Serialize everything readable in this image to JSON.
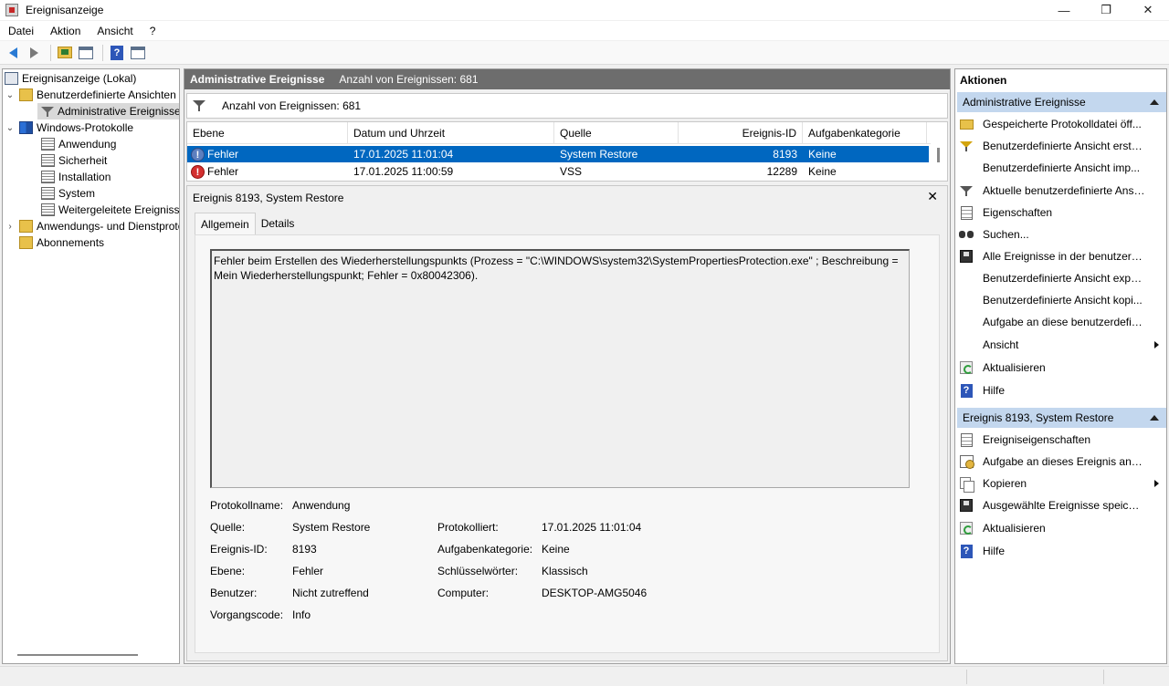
{
  "window": {
    "title": "Ereignisanzeige",
    "controls": {
      "minimize": "—",
      "maximize": "❐",
      "close": "✕"
    }
  },
  "menu": [
    "Datei",
    "Aktion",
    "Ansicht",
    "?"
  ],
  "toolbar": {
    "icons": [
      "back-arrow",
      "forward-arrow",
      "up-folder",
      "show-hide-console-tree",
      "help",
      "show-hide-action-pane"
    ],
    "help_glyph": "?"
  },
  "tree": {
    "root": "Ereignisanzeige (Lokal)",
    "custom_views": "Benutzerdefinierte Ansichten",
    "admin_events": "Administrative Ereignisse",
    "windows_logs": "Windows-Protokolle",
    "application": "Anwendung",
    "security": "Sicherheit",
    "setup": "Installation",
    "system": "System",
    "forwarded": "Weitergeleitete Ereignisse",
    "app_service_logs": "Anwendungs- und Dienstprotokolle",
    "subscriptions": "Abonnements",
    "expand_glyph": "›",
    "collapse_glyph": "⌄"
  },
  "center": {
    "header_title": "Administrative Ereignisse",
    "header_count": "Anzahl von Ereignissen: 681",
    "filter_text": "Anzahl von Ereignissen: 681",
    "columns": [
      "Ebene",
      "Datum und Uhrzeit",
      "Quelle",
      "Ereignis-ID",
      "Aufgabenkategorie"
    ],
    "rows": [
      {
        "level": "Fehler",
        "datetime": "17.01.2025 11:01:04",
        "source": "System Restore",
        "event_id": "8193",
        "category": "Keine",
        "selected": true,
        "icon_glyph": "!"
      },
      {
        "level": "Fehler",
        "datetime": "17.01.2025 11:00:59",
        "source": "VSS",
        "event_id": "12289",
        "category": "Keine",
        "selected": false,
        "icon_glyph": "!"
      }
    ]
  },
  "detail": {
    "title": "Ereignis 8193, System Restore",
    "close_glyph": "✕",
    "tabs": [
      "Allgemein",
      "Details"
    ],
    "message": "Fehler beim Erstellen des Wiederherstellungspunkts (Prozess = \"C:\\WINDOWS\\system32\\SystemPropertiesProtection.exe\" ; Beschreibung = Mein Wiederherstellungspunkt; Fehler = 0x80042306).",
    "props": {
      "log_name_label": "Protokollname:",
      "log_name": "Anwendung",
      "source_label": "Quelle:",
      "source": "System Restore",
      "logged_label": "Protokolliert:",
      "logged": "17.01.2025 11:01:04",
      "event_id_label": "Ereignis-ID:",
      "event_id": "8193",
      "task_cat_label": "Aufgabenkategorie:",
      "task_cat": "Keine",
      "level_label": "Ebene:",
      "level": "Fehler",
      "keywords_label": "Schlüsselwörter:",
      "keywords": "Klassisch",
      "user_label": "Benutzer:",
      "user": "Nicht zutreffend",
      "computer_label": "Computer:",
      "computer": "DESKTOP-AMG5046",
      "opcode_label": "Vorgangscode:",
      "opcode": "Info"
    }
  },
  "actions": {
    "title": "Aktionen",
    "section1": "Administrative Ereignisse",
    "section1_items": [
      "Gespeicherte Protokolldatei öff...",
      "Benutzerdefinierte Ansicht erste...",
      "Benutzerdefinierte Ansicht imp...",
      "Aktuelle benutzerdefinierte Ansi...",
      "Eigenschaften",
      "Suchen...",
      "Alle Ereignisse in der benutzerd...",
      "Benutzerdefinierte Ansicht expo...",
      "Benutzerdefinierte Ansicht kopi...",
      "Aufgabe an diese benutzerdefin...",
      "Ansicht",
      "Aktualisieren",
      "Hilfe"
    ],
    "section2": "Ereignis 8193, System Restore",
    "section2_items": [
      "Ereigniseigenschaften",
      "Aufgabe an dieses Ereignis anfü...",
      "Kopieren",
      "Ausgewählte Ereignisse speiche...",
      "Aktualisieren",
      "Hilfe"
    ],
    "help_glyph": "?"
  },
  "colors": {
    "selection": "#0067c0",
    "section_header": "#c3d7ee",
    "center_header": "#6d6d6d",
    "error_red": "#d32f2f"
  }
}
